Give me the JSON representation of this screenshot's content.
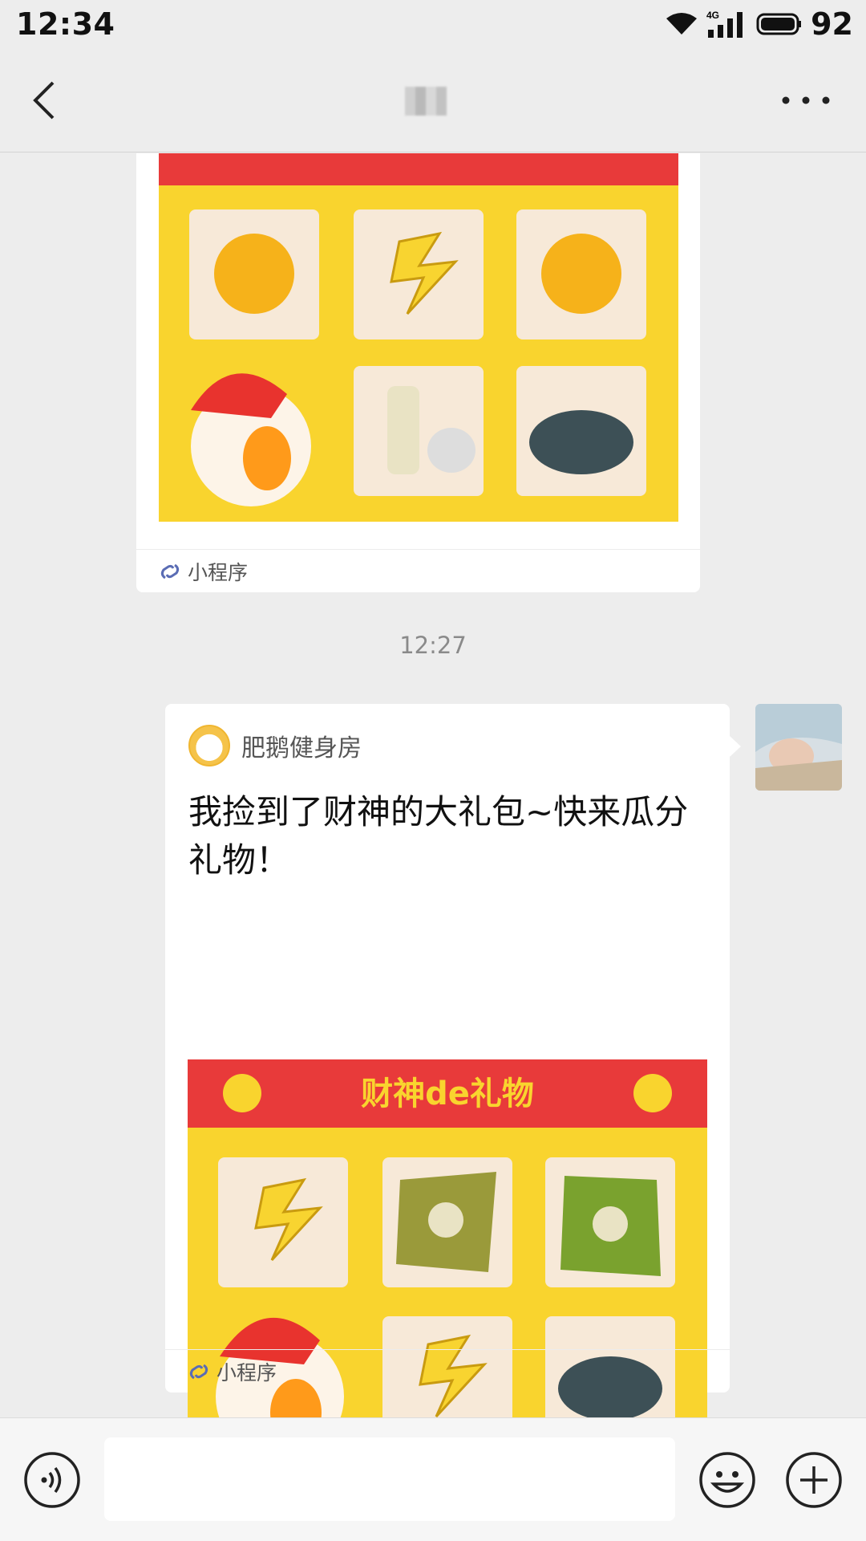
{
  "status_bar": {
    "time": "12:34",
    "network": "4G",
    "battery": "92"
  },
  "nav": {
    "back_icon": "chevron-left-icon",
    "more_icon": "more-dots-icon"
  },
  "messages": [
    {
      "type": "mini-program",
      "label": "小程序",
      "image": "gift-grid"
    },
    {
      "type": "time",
      "text": "12:27"
    },
    {
      "type": "mini-program",
      "source": "肥鹅健身房",
      "title": "我捡到了财神的大礼包~快来瓜分礼物！",
      "image_banner": "财神de礼物",
      "label": "小程序"
    }
  ],
  "bottom": {
    "voice_icon": "voice-icon",
    "emoji_icon": "emoji-icon",
    "plus_icon": "plus-icon"
  },
  "colors": {
    "bg": "#ededed",
    "card_bg": "#ffffff",
    "banner_red": "#e83a3a",
    "gift_yellow": "#f9d42e"
  }
}
